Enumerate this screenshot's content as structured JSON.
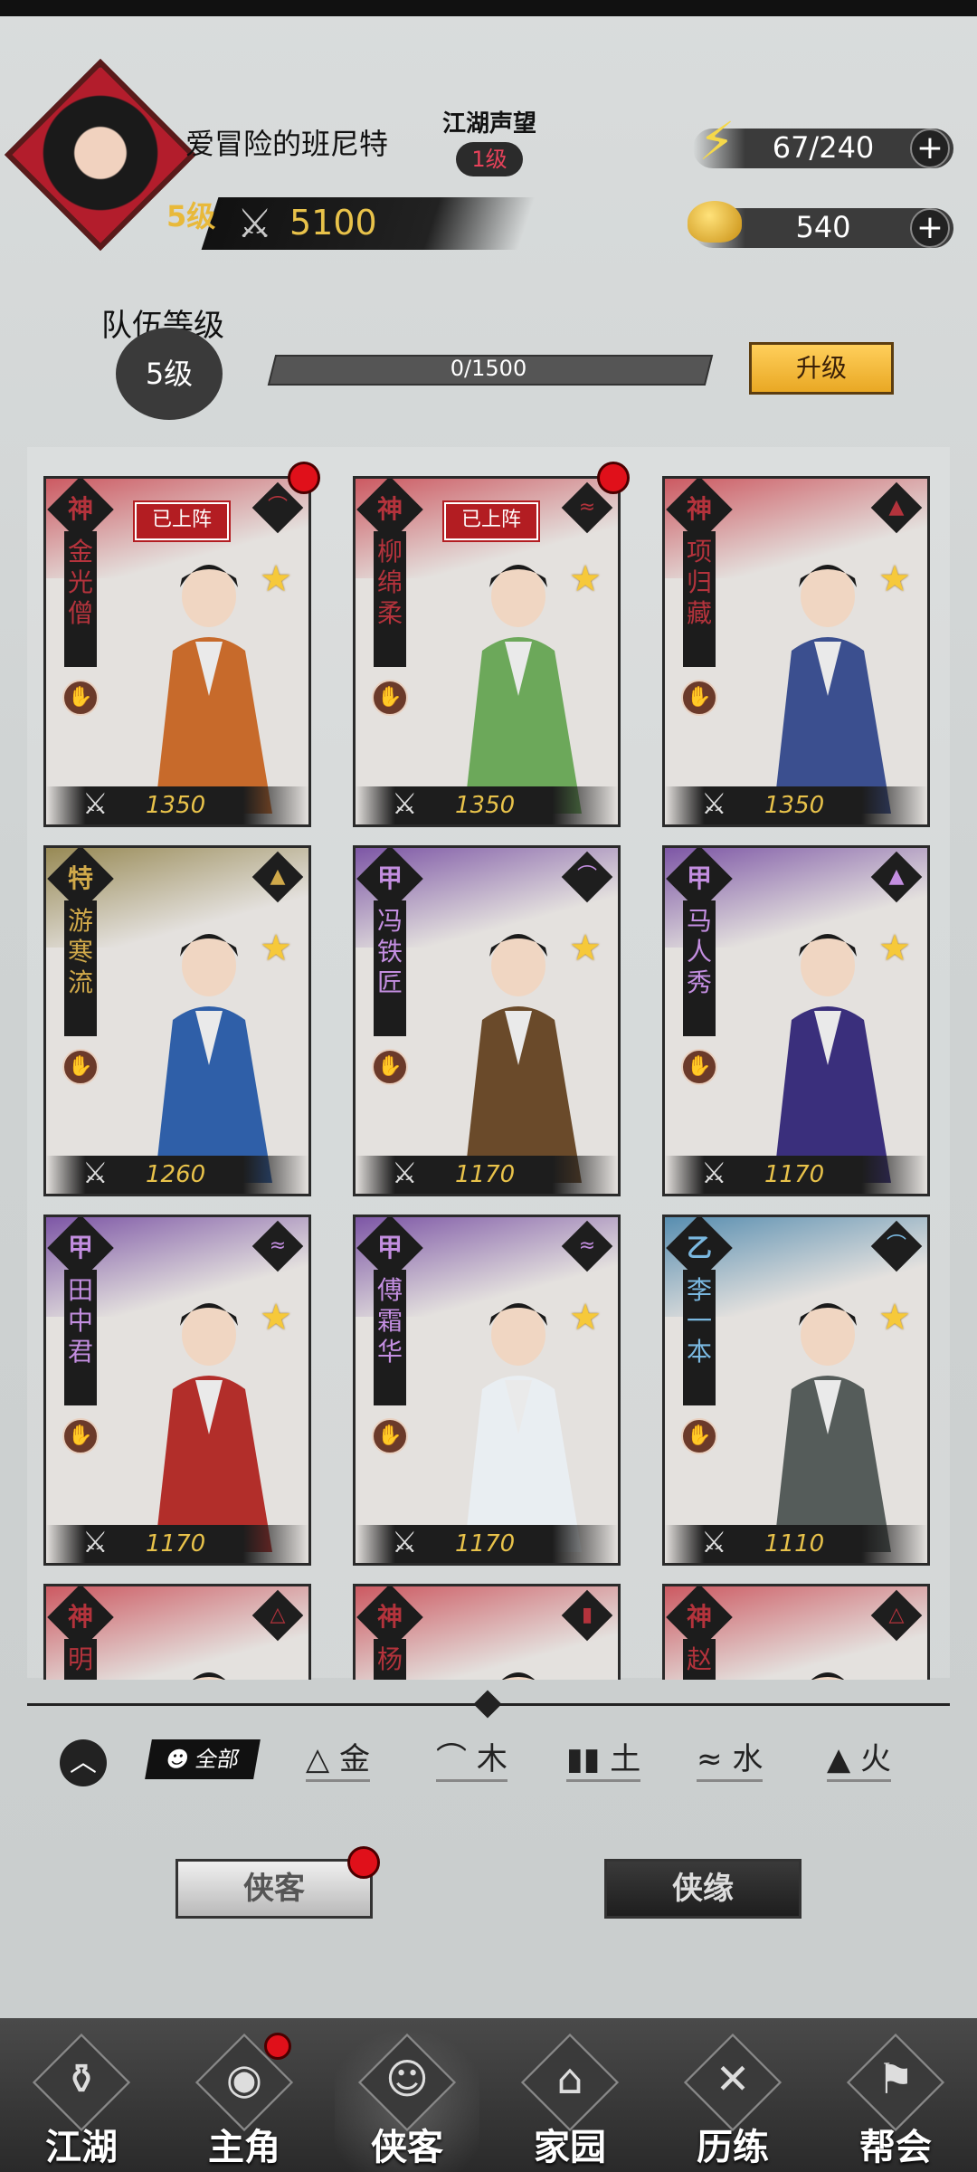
{
  "player": {
    "name": "爱冒险的班尼特",
    "level": "5级",
    "power": "5100",
    "reputation_title": "江湖声望",
    "reputation_level": "1级"
  },
  "resources": {
    "energy": "67/240",
    "gold": "540"
  },
  "team": {
    "label": "队伍等级",
    "level": "5级",
    "exp": "0/1500",
    "exp_fraction": 0,
    "upgrade_label": "升级"
  },
  "heroes": [
    {
      "rank": "神",
      "name": "金光僧",
      "power": "1350",
      "element": "木",
      "deployed": "已上阵",
      "red_dot": true,
      "color": "#b4333c",
      "swash": "#c8424c",
      "robe": "#c76a2b"
    },
    {
      "rank": "神",
      "name": "柳绵柔",
      "power": "1350",
      "element": "水",
      "deployed": "已上阵",
      "red_dot": true,
      "color": "#b4333c",
      "swash": "#c8424c",
      "robe": "#6ca85a"
    },
    {
      "rank": "神",
      "name": "项归藏",
      "power": "1350",
      "element": "火",
      "deployed": "",
      "red_dot": false,
      "color": "#b4333c",
      "swash": "#c8424c",
      "robe": "#3b4f8f"
    },
    {
      "rank": "特",
      "name": "游寒流",
      "power": "1260",
      "element": "火",
      "deployed": "",
      "red_dot": false,
      "color": "#d0a94a",
      "swash": "#8a7a3c",
      "robe": "#2f5fa8"
    },
    {
      "rank": "甲",
      "name": "冯铁匠",
      "power": "1170",
      "element": "木",
      "deployed": "",
      "red_dot": false,
      "color": "#c38ee0",
      "swash": "#6b3e9c",
      "robe": "#6a4a2a"
    },
    {
      "rank": "甲",
      "name": "马人秀",
      "power": "1170",
      "element": "火",
      "deployed": "",
      "red_dot": false,
      "color": "#c38ee0",
      "swash": "#6b3e9c",
      "robe": "#3a2f7c"
    },
    {
      "rank": "甲",
      "name": "田中君",
      "power": "1170",
      "element": "水",
      "deployed": "",
      "red_dot": false,
      "color": "#c38ee0",
      "swash": "#6b3e9c",
      "robe": "#b22e2a"
    },
    {
      "rank": "甲",
      "name": "傅霜华",
      "power": "1170",
      "element": "水",
      "deployed": "",
      "red_dot": false,
      "color": "#c38ee0",
      "swash": "#6b3e9c",
      "robe": "#e9eef2"
    },
    {
      "rank": "乙",
      "name": "李一本",
      "power": "1110",
      "element": "木",
      "deployed": "",
      "red_dot": false,
      "color": "#7ab8e0",
      "swash": "#3f7fa8",
      "robe": "#555c5a"
    },
    {
      "rank": "神",
      "name": "明",
      "power": "",
      "element": "金",
      "deployed": "",
      "red_dot": false,
      "color": "#b4333c",
      "swash": "#c8424c",
      "robe": "#222"
    },
    {
      "rank": "神",
      "name": "杨",
      "power": "",
      "element": "土",
      "deployed": "",
      "red_dot": false,
      "color": "#b4333c",
      "swash": "#c8424c",
      "robe": "#222"
    },
    {
      "rank": "神",
      "name": "赵",
      "power": "",
      "element": "金",
      "deployed": "",
      "red_dot": false,
      "color": "#b4333c",
      "swash": "#c8424c",
      "robe": "#222"
    }
  ],
  "filters": {
    "all": "全部",
    "items": [
      {
        "icon": "△",
        "label": "金"
      },
      {
        "icon": "⌒",
        "label": "木"
      },
      {
        "icon": "▮▮",
        "label": "土"
      },
      {
        "icon": "≈",
        "label": "水"
      },
      {
        "icon": "▲",
        "label": "火"
      }
    ]
  },
  "tabs": {
    "heroes": "侠客",
    "bonds": "侠缘"
  },
  "nav": [
    {
      "label": "江湖",
      "glyph": "⚱",
      "active": false
    },
    {
      "label": "主角",
      "glyph": "◉",
      "active": false,
      "red_dot": true
    },
    {
      "label": "侠客",
      "glyph": "☺",
      "active": true
    },
    {
      "label": "家园",
      "glyph": "⌂",
      "active": false
    },
    {
      "label": "历练",
      "glyph": "✕",
      "active": false
    },
    {
      "label": "帮会",
      "glyph": "⚑",
      "active": false
    }
  ],
  "icons": {
    "energy": "lightning-icon",
    "gold": "gold-ingot-icon",
    "power": "crossed-swords-icon"
  }
}
